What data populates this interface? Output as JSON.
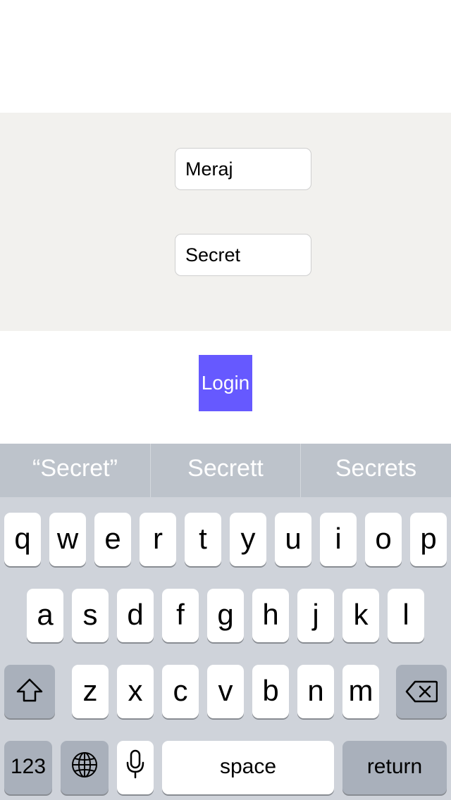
{
  "form": {
    "username_value": "Meraj",
    "password_value": "Secret",
    "login_label": "Login"
  },
  "colors": {
    "form_panel_bg": "#f2f1ee",
    "login_button_bg": "#6659ff",
    "keyboard_bg": "#cfd3da",
    "suggestion_bar_bg": "#bdc3cb"
  },
  "keyboard": {
    "suggestions": [
      "“Secret”",
      "Secrett",
      "Secrets"
    ],
    "row1": [
      "q",
      "w",
      "e",
      "r",
      "t",
      "y",
      "u",
      "i",
      "o",
      "p"
    ],
    "row2": [
      "a",
      "s",
      "d",
      "f",
      "g",
      "h",
      "j",
      "k",
      "l"
    ],
    "row3": [
      "z",
      "x",
      "c",
      "v",
      "b",
      "n",
      "m"
    ],
    "numbers_label": "123",
    "space_label": "space",
    "return_label": "return",
    "icons": {
      "shift": "shift-icon",
      "delete": "backspace-icon",
      "globe": "globe-icon",
      "mic": "microphone-icon"
    }
  }
}
